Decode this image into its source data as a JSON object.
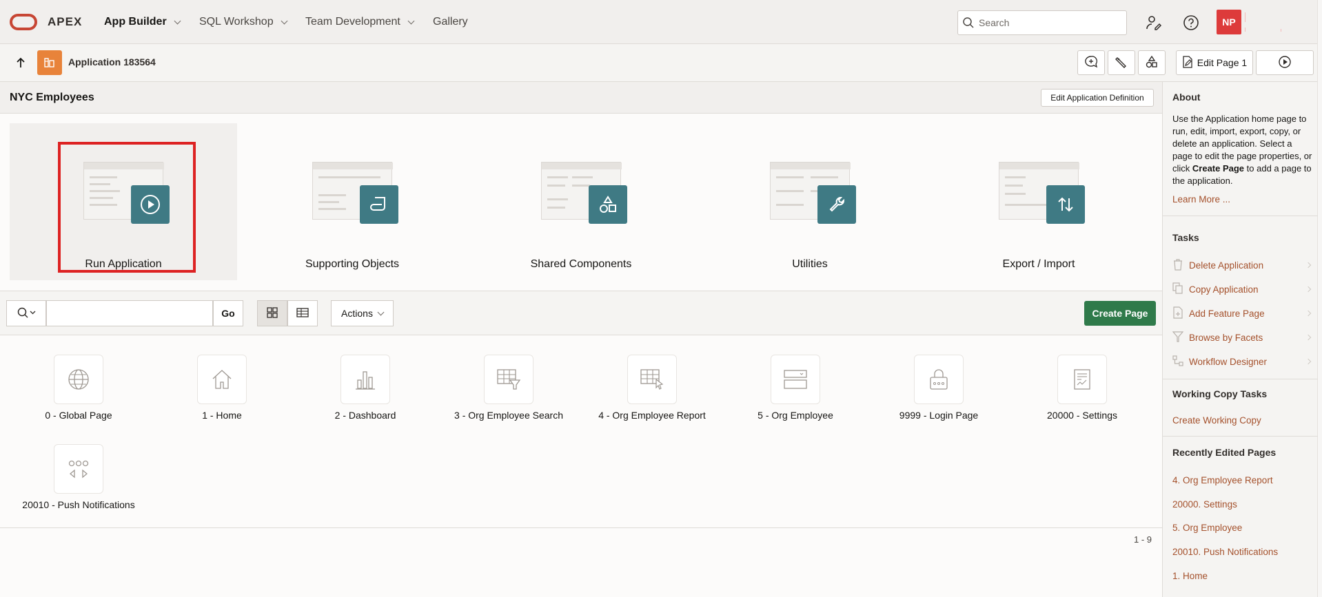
{
  "topbar": {
    "brand": "APEX",
    "nav": [
      {
        "label": "App Builder",
        "active": true
      },
      {
        "label": "SQL Workshop"
      },
      {
        "label": "Team Development"
      },
      {
        "label": "Gallery"
      }
    ],
    "search_placeholder": "Search",
    "user_initials": "NP"
  },
  "appbar": {
    "title": "Application 183564",
    "edit_page_label": "Edit Page 1"
  },
  "main": {
    "title": "NYC Employees",
    "edit_app_def_label": "Edit Application Definition",
    "tiles": [
      {
        "label": "Run Application",
        "icon": "play-icon"
      },
      {
        "label": "Supporting Objects",
        "icon": "scroll-icon"
      },
      {
        "label": "Shared Components",
        "icon": "shapes-icon"
      },
      {
        "label": "Utilities",
        "icon": "wrench-icon"
      },
      {
        "label": "Export / Import",
        "icon": "up-down-arrows-icon"
      }
    ],
    "go_label": "Go",
    "actions_label": "Actions",
    "create_page_label": "Create Page",
    "pages": [
      {
        "label": "0 - Global Page",
        "icon": "globe-icon"
      },
      {
        "label": "1 - Home",
        "icon": "home-icon"
      },
      {
        "label": "2 - Dashboard",
        "icon": "bar-chart-icon"
      },
      {
        "label": "3 - Org Employee Search",
        "icon": "grid-filter-icon"
      },
      {
        "label": "4 - Org Employee Report",
        "icon": "grid-cursor-icon"
      },
      {
        "label": "5 - Org Employee",
        "icon": "form-icon"
      },
      {
        "label": "9999 - Login Page",
        "icon": "lock-icon"
      },
      {
        "label": "20000 - Settings",
        "icon": "settings-doc-icon"
      },
      {
        "label": "20010 - Push Notifications",
        "icon": "push-notification-icon"
      }
    ],
    "range": "1 - 9"
  },
  "sidebar": {
    "about_heading": "About",
    "about_text_1": "Use the Application home page to run, edit, import, export, copy, or delete an application. Select a page to edit the page properties, or click ",
    "about_bold": "Create Page",
    "about_text_2": " to add a page to the application.",
    "learn_more": "Learn More ...",
    "tasks_heading": "Tasks",
    "tasks": [
      {
        "label": "Delete Application",
        "icon": "trash-icon"
      },
      {
        "label": "Copy Application",
        "icon": "copy-icon"
      },
      {
        "label": "Add Feature Page",
        "icon": "add-page-icon"
      },
      {
        "label": "Browse by Facets",
        "icon": "funnel-icon"
      },
      {
        "label": "Workflow Designer",
        "icon": "workflow-icon"
      }
    ],
    "working_copy_heading": "Working Copy Tasks",
    "create_working_copy": "Create Working Copy",
    "recent_heading": "Recently Edited Pages",
    "recent": [
      "4. Org Employee Report",
      "20000. Settings",
      "5. Org Employee",
      "20010. Push Notifications",
      "1. Home"
    ]
  }
}
